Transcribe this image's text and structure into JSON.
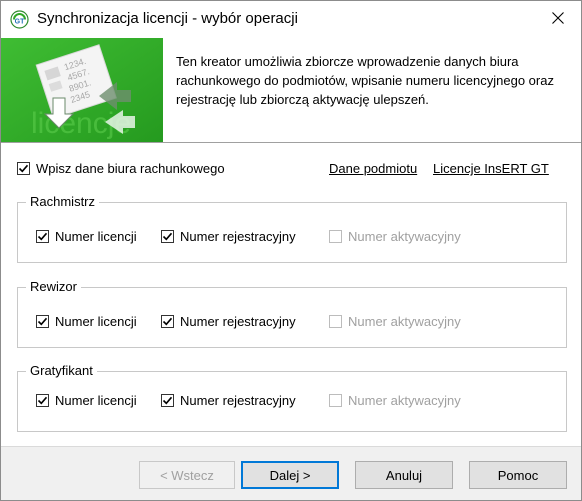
{
  "window": {
    "title": "Synchronizacja licencji - wybór operacji"
  },
  "banner": {
    "text": "Ten kreator umożliwia zbiorcze wprowadzenie danych biura rachunkowego do podmiotów, wpisanie numeru licencyjnego oraz rejestrację lub zbiorczą aktywację ulepszeń.",
    "graphic_numbers": [
      "1234.",
      "4567.",
      "8901.",
      "2345"
    ],
    "graphic_word": "licencje"
  },
  "office_checkbox": {
    "label": "Wpisz dane biura rachunkowego",
    "checked": true
  },
  "links": {
    "entity_data": "Dane podmiotu",
    "insert_licenses": "Licencje InsERT GT"
  },
  "groups": [
    {
      "title": "Rachmistrz",
      "license": {
        "label": "Numer licencji",
        "checked": true
      },
      "registration": {
        "label": "Numer rejestracyjny",
        "checked": true
      },
      "activation": {
        "label": "Numer aktywacyjny",
        "checked": false,
        "disabled": true
      }
    },
    {
      "title": "Rewizor",
      "license": {
        "label": "Numer licencji",
        "checked": true
      },
      "registration": {
        "label": "Numer rejestracyjny",
        "checked": true
      },
      "activation": {
        "label": "Numer aktywacyjny",
        "checked": false,
        "disabled": true
      }
    },
    {
      "title": "Gratyfikant",
      "license": {
        "label": "Numer licencji",
        "checked": true
      },
      "registration": {
        "label": "Numer rejestracyjny",
        "checked": true
      },
      "activation": {
        "label": "Numer aktywacyjny",
        "checked": false,
        "disabled": true
      }
    }
  ],
  "buttons": {
    "back": "< Wstecz",
    "next": "Dalej >",
    "cancel": "Anuluj",
    "help": "Pomoc"
  },
  "colors": {
    "banner_green": "#35b02a",
    "accent_blue": "#0078d7",
    "disabled_gray": "#a0a0a0"
  },
  "icons": {
    "app": "insert-gt-icon",
    "close": "close-icon",
    "check": "checkmark-icon"
  }
}
